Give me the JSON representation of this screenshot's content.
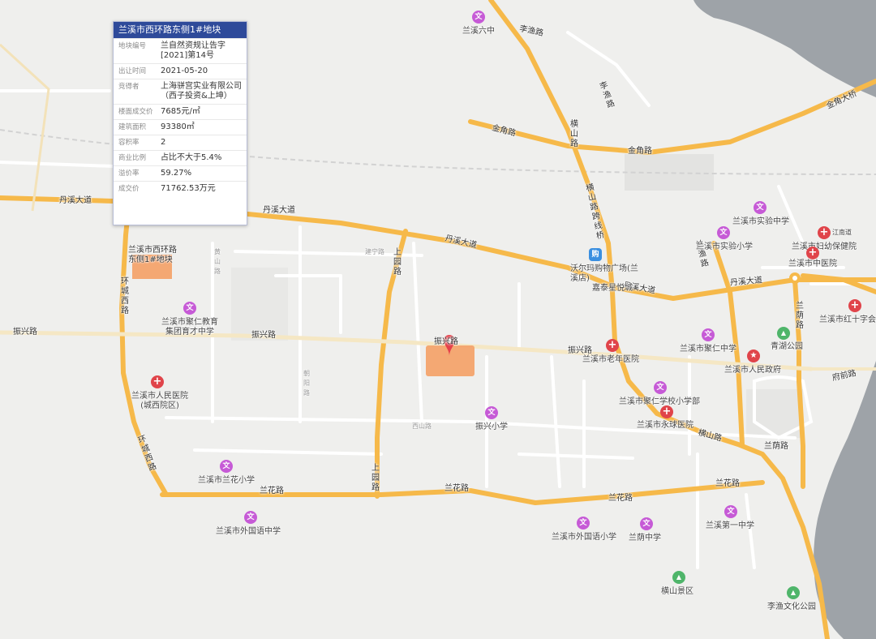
{
  "card": {
    "title": "兰溪市西环路东侧1#地块",
    "rows": [
      {
        "k": "地块编号",
        "v": "兰自然资规让告字[2021]第14号"
      },
      {
        "k": "出让时间",
        "v": "2021-05-20"
      },
      {
        "k": "竞得者",
        "v": "上海骈宫实业有限公司（西子投资&上坤）"
      },
      {
        "k": "楼面成交价",
        "v": "7685元/㎡"
      },
      {
        "k": "建筑面积",
        "v": "93380㎡"
      },
      {
        "k": "容积率",
        "v": "2"
      },
      {
        "k": "商业比例",
        "v": "占比不大于5.4%"
      },
      {
        "k": "溢价率",
        "v": "59.27%"
      },
      {
        "k": "成交价",
        "v": "71762.53万元"
      }
    ]
  },
  "parcel_label": "兰溪市西环路东侧1#地块",
  "roads": {
    "danxi_1": "丹溪大道",
    "danxi_2": "丹溪大道",
    "danxi_3": "丹溪大道",
    "danxi_4": "丹溪大道",
    "danxi_5": "丹溪大道",
    "zhenxing_1": "振兴路",
    "zhenxing_2": "振兴路",
    "zhenxing_3": "振兴路",
    "zhenxing_4": "振兴路",
    "lanhua_1": "兰花路",
    "lanhua_2": "兰花路",
    "lanhua_3": "兰花路",
    "lanhua_4": "兰花路",
    "jinjiao_1": "金角路",
    "jinjiao_2": "金角路",
    "jinjiao_bridge": "金角大桥",
    "liyu_1": "李渔路",
    "liyu_2": "李渔路",
    "hengshan_1": "横山路",
    "hengshan_bridge": "横山路跨线桥",
    "hengshan_2": "横山路",
    "shangyuan_1": "上园路",
    "shangyuan_2": "上园路",
    "huancheng_w1": "环城西路",
    "huancheng_w2": "环城西路",
    "lanyin_1": "兰荫路",
    "lanyin_2": "兰荫路",
    "fuqian": "府前路",
    "jianning_1": "建宁路",
    "xishan": "西山路",
    "chaoyang": "朝阳路",
    "huangshan": "黄山路",
    "jiangyu": "兰渔路"
  },
  "pois": {
    "lanxi6": "兰溪六中",
    "shiyan_mid": "兰溪市实验中学",
    "fuyou": "兰溪市妇幼保健院",
    "shiyan_pri": "兰溪市实验小学",
    "zhongyi": "兰溪市中医院",
    "walmart": "沃尔玛购物广场(兰溪店)",
    "jiatai": "嘉泰星悦城",
    "hongshizi": "兰溪市红十字会",
    "qinghu": "青湖公园",
    "laonian": "兰溪市老年医院",
    "renmin_gov": "兰溪市人民政府",
    "juren_mid": "兰溪市聚仁中学",
    "juren_edu": "兰溪市聚仁教育集团育才中学",
    "renmin_hosp": "兰溪市人民医院(城西院区)",
    "juren_pri": "兰溪市聚仁学校小学部",
    "yongqiu": "兰溪市永球医院",
    "zhenxing_pri": "振兴小学",
    "lanhua_pri": "兰溪市兰花小学",
    "waiguoyu_mid": "兰溪市外国语中学",
    "waiguoyu_pri": "兰溪市外国语小学",
    "lanyin_mid": "兰荫中学",
    "diyi_mid": "兰溪第一中学",
    "hengshan_scenic": "横山景区",
    "liyu_park": "李渔文化公园",
    "jiangnan": "江南道"
  },
  "icons": {
    "edu": "文",
    "hosp": "+",
    "gov": "★",
    "park": "▲",
    "shop": "购"
  },
  "colors": {
    "road_major": "#f6b94a",
    "road_minor": "#ffffff",
    "water": "#9ea3a8",
    "card_head": "#2e4a9a",
    "parcel": "#f3a36d",
    "pin": "#e5404a"
  }
}
